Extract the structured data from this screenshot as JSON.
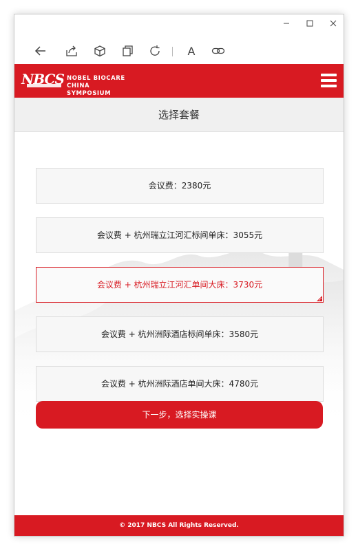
{
  "window_controls": {
    "minimize": "—",
    "maximize": "☐",
    "close": "✕"
  },
  "toolbar": {
    "icons": [
      "back-arrow-icon",
      "share-icon",
      "cube-icon",
      "copy-icon",
      "refresh-icon",
      "font-icon",
      "link-icon"
    ],
    "font_label": "A"
  },
  "header": {
    "logo_main": "NBCS",
    "logo_line1": "NOBEL  BIOCARE",
    "logo_line2": "CHINA  SYMPOSIUM",
    "brand_color": "#d81a22"
  },
  "page": {
    "title": "选择套餐"
  },
  "options": [
    {
      "label": "会议费：2380元",
      "selected": false
    },
    {
      "label": "会议费 + 杭州瑞立江河汇标间单床：3055元",
      "selected": false
    },
    {
      "label": "会议费 + 杭州瑞立江河汇单间大床：3730元",
      "selected": true
    },
    {
      "label": "会议费 + 杭州洲际酒店标间单床：3580元",
      "selected": false
    },
    {
      "label": "会议费 + 杭州洲际酒店单间大床：4780元",
      "selected": false
    }
  ],
  "next_button": "下一步，选择实操课",
  "footer": "© 2017 NBCS All Rights Reserved."
}
